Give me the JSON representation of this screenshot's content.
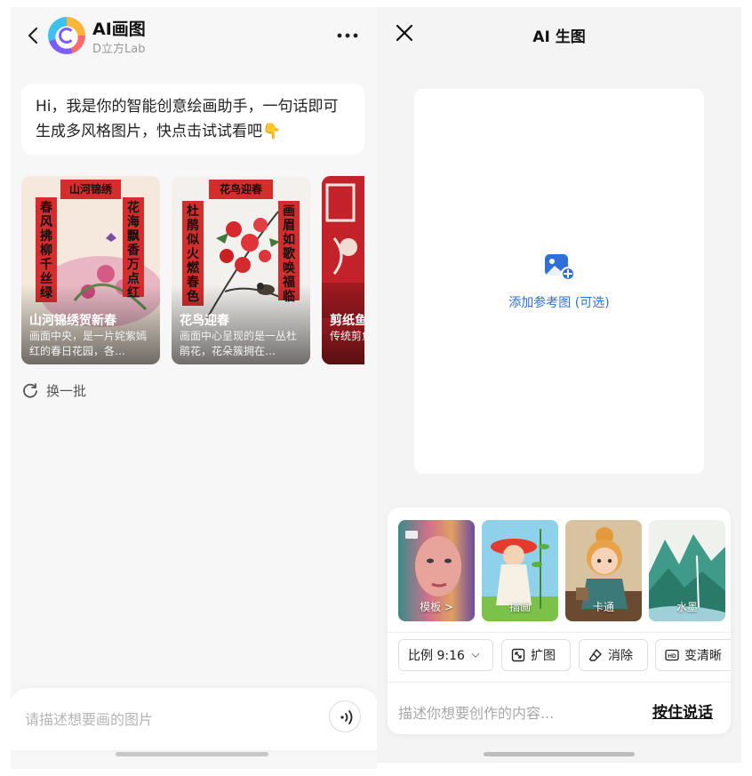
{
  "left": {
    "header": {
      "title": "AI画图",
      "subtitle": "D立方Lab"
    },
    "greeting": "Hi，我是你的智能创意绘画助手，一句话即可生成多风格图片，快点击试试看吧👇",
    "cards": [
      {
        "title": "山河锦绣贺新春",
        "desc": "画面中央，是一片姹紫嫣红的春日花园，各…",
        "banner": "山河锦绣",
        "couplet_left": "春风拂柳千丝绿",
        "couplet_right": "花海飘香万点红"
      },
      {
        "title": "花鸟迎春",
        "desc": "画面中心呈现的是一丛杜鹃花，花朵簇拥在…",
        "banner": "花鸟迎春",
        "couplet_left": "杜鹃似火燃春色",
        "couplet_right": "画眉如歌唤福临"
      },
      {
        "title": "剪纸鱼",
        "desc": "传统剪鱼挂在"
      }
    ],
    "refresh_label": "换一批",
    "input_placeholder": "请描述想要画的图片"
  },
  "right": {
    "title": "AI 生图",
    "reference_label": "添加参考图 (可选)",
    "styles": [
      {
        "label": "模板 >"
      },
      {
        "label": "插画"
      },
      {
        "label": "卡通"
      },
      {
        "label": "水墨"
      }
    ],
    "tools": [
      {
        "label": "比例  9:16"
      },
      {
        "label": "扩图"
      },
      {
        "label": "消除"
      },
      {
        "label": "变清晰"
      }
    ],
    "input_placeholder": "描述你想要创作的内容...",
    "hold_to_talk": "按住说话"
  },
  "colors": {
    "accent_blue": "#2f6fd8",
    "festive_red": "#d42d2d"
  }
}
